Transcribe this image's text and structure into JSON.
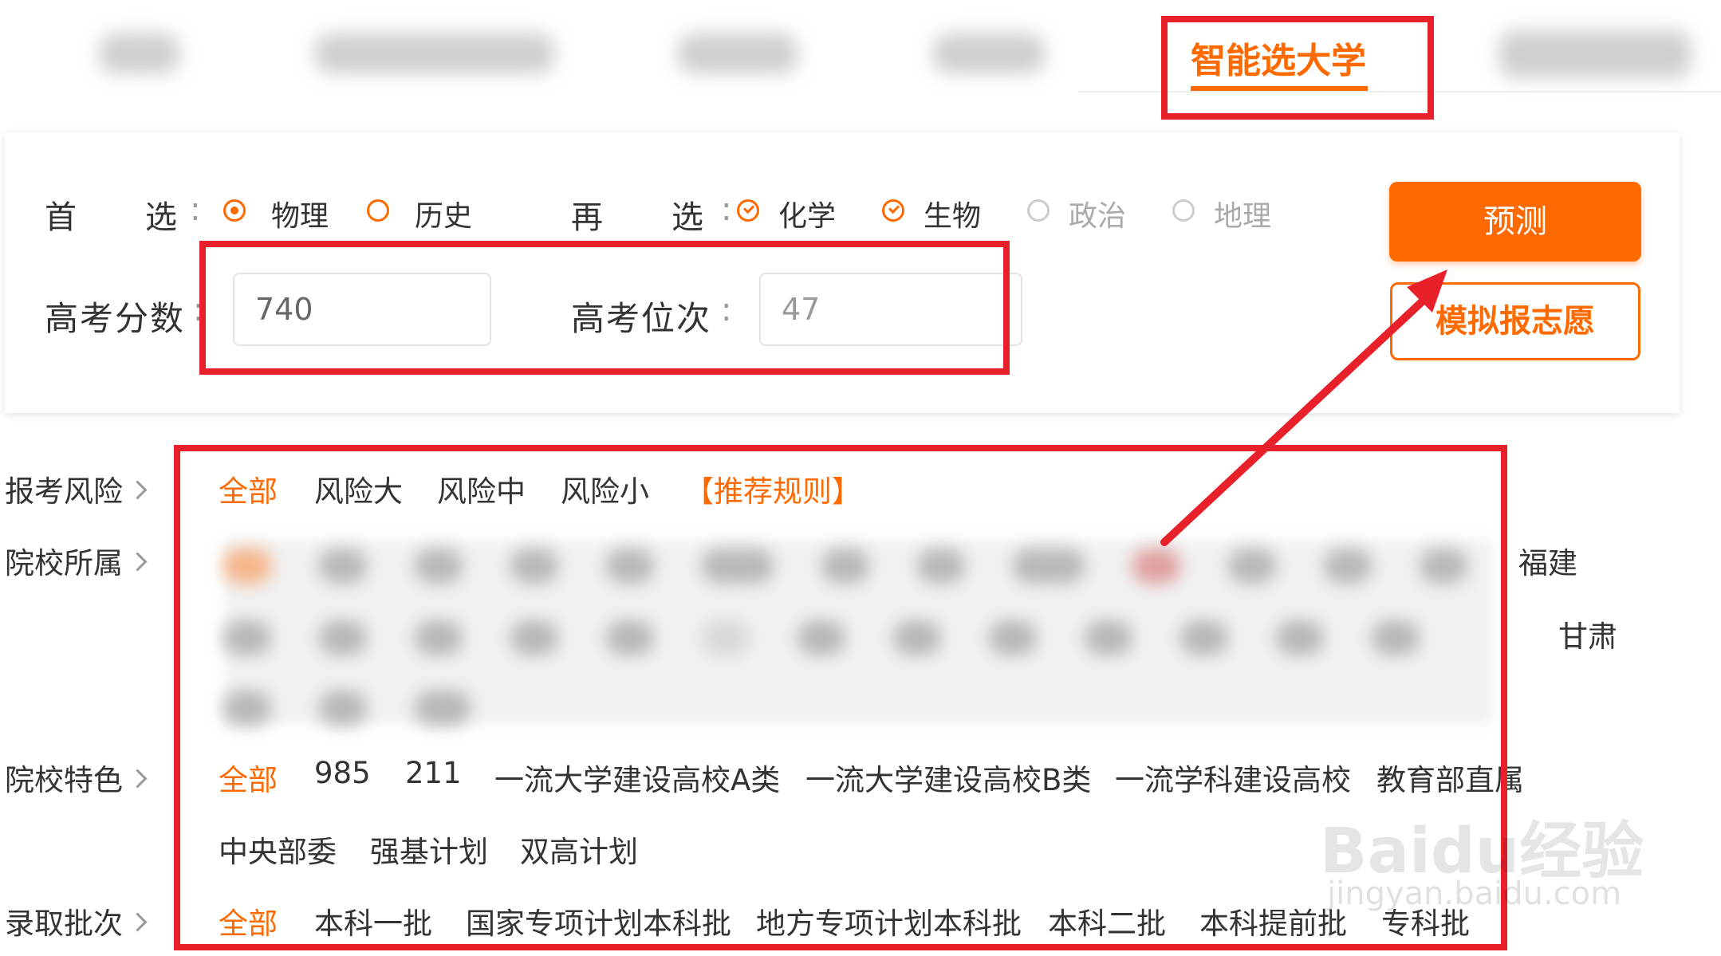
{
  "top_nav": {
    "active_tab": "智能选大学"
  },
  "form": {
    "primary_label": "首　　选",
    "primary_options": [
      {
        "label": "物理",
        "selected": true
      },
      {
        "label": "历史",
        "selected": false
      }
    ],
    "secondary_label": "再　　选",
    "secondary_options": [
      {
        "label": "化学",
        "checked": true
      },
      {
        "label": "生物",
        "checked": true
      },
      {
        "label": "政治",
        "checked": false
      },
      {
        "label": "地理",
        "checked": false
      }
    ],
    "score_label": "高考分数",
    "score_value": "740",
    "rank_label": "高考位次",
    "rank_value": "47",
    "predict_button": "预测",
    "simulate_button": "模拟报志愿"
  },
  "filters": {
    "risk": {
      "label": "报考风险",
      "options": [
        "全部",
        "风险大",
        "风险中",
        "风险小"
      ],
      "rules_link": "【推荐规则】"
    },
    "affiliation": {
      "label": "院校所属",
      "visible_options": [
        "福建",
        "甘肃"
      ]
    },
    "features": {
      "label": "院校特色",
      "options": [
        "全部",
        "985",
        "211",
        "一流大学建设高校A类",
        "一流大学建设高校B类",
        "一流学科建设高校",
        "教育部直属",
        "中央部委",
        "强基计划",
        "双高计划"
      ]
    },
    "batch": {
      "label": "录取批次",
      "options": [
        "全部",
        "本科一批",
        "国家专项计划本科批",
        "地方专项计划本科批",
        "本科二批",
        "本科提前批",
        "专科批"
      ]
    }
  },
  "watermark": {
    "brand": "Baidu经验",
    "url": "jingyan.baidu.com"
  },
  "colors": {
    "accent": "#ff6a00",
    "annotation_red": "#e8202a"
  }
}
